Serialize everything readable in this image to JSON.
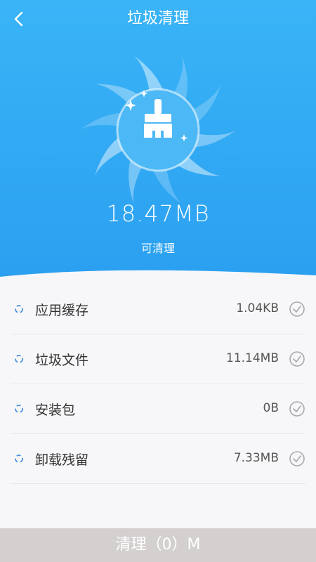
{
  "header": {
    "title": "垃圾清理",
    "total_size": "18.47MB",
    "total_label": "可清理"
  },
  "items": [
    {
      "label": "应用缓存",
      "size": "1.04KB"
    },
    {
      "label": "垃圾文件",
      "size": "11.14MB"
    },
    {
      "label": "安装包",
      "size": "0B"
    },
    {
      "label": "卸载残留",
      "size": "7.33MB"
    }
  ],
  "clean_button": {
    "label": "清理（0）M"
  },
  "icons": {
    "back": "chevron-left-icon",
    "center": "broom-icon",
    "row_status": "spinner-icon",
    "row_check": "check-circle-icon"
  },
  "colors": {
    "header_top": "#3ab4f7",
    "header_bottom": "#2a9ff0",
    "button_bg": "#d4d0d0"
  }
}
